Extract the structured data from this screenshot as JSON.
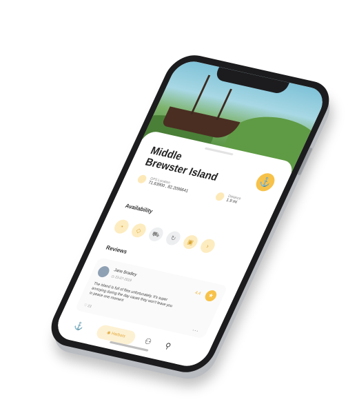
{
  "place": {
    "title_line1": "Middle",
    "title_line2": "Brewster Island",
    "gps_label": "GPS Location",
    "gps_value": "71.63900 , 82.2096641",
    "distance_label": "Distance",
    "distance_value": "1.9 mi"
  },
  "sections": {
    "availability": "Availability",
    "reviews": "Reviews"
  },
  "availability_icons": [
    "clock-icon",
    "tag-icon",
    "cart-icon",
    "refresh-icon",
    "bag-icon",
    "more-icon"
  ],
  "review": {
    "name": "Jane Bradley",
    "date": "23-07-2019",
    "rating": "4.4",
    "text": "The island is full of flies unfortunately. It's super annoying during the day cause they won't leave you in peace one moment",
    "likes": "23",
    "more": "..."
  },
  "nav": {
    "explore": "Harbors"
  },
  "colors": {
    "accent": "#f7c24a",
    "accent_light": "#fdecc0"
  }
}
